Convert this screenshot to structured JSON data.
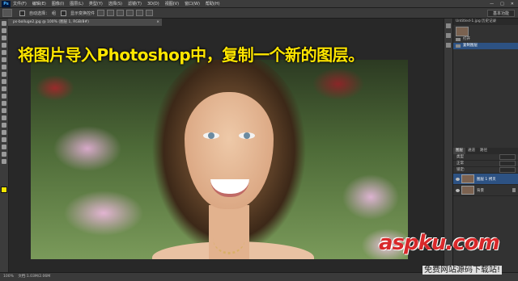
{
  "app": {
    "logo": "Ps"
  },
  "menubar": {
    "items": [
      "文件(F)",
      "编辑(E)",
      "图像(I)",
      "图层(L)",
      "类型(Y)",
      "选择(S)",
      "滤镜(T)",
      "3D(D)",
      "视图(V)",
      "窗口(W)",
      "帮助(H)"
    ],
    "window_controls": [
      "—",
      "□",
      "✕"
    ]
  },
  "options_bar": {
    "auto_select_label": "自动选择：",
    "group_value": "组",
    "show_transform_label": "显示变换控件",
    "workspace": "基本功能"
  },
  "document": {
    "tab_label": "ps-bolluge2.jpg @ 100% (图层 1, RGB/8#)",
    "caption": "将图片导入Photoshop中，复制一个新的图层。"
  },
  "history_panel": {
    "header": "Untitled-1.jpg 历史记录",
    "items": [
      {
        "label": "打开"
      },
      {
        "label": "复制图层"
      }
    ]
  },
  "layers_panel": {
    "tabs": [
      "图层",
      "通道",
      "路径"
    ],
    "kind_label": "类型",
    "mode_label": "正常",
    "lock_label": "锁定:",
    "layers": [
      {
        "name": "图层 1 拷贝"
      },
      {
        "name": "背景"
      }
    ]
  },
  "status_bar": {
    "zoom": "100%",
    "doc_info": "文档:1.03M/2.06M"
  },
  "watermark": {
    "brand": "aspku.com",
    "tagline": "免费网站源码下载站!"
  },
  "colors": {
    "caption": "#ffe600",
    "foreground_swatch": "#f4e600",
    "selection": "#2d5283",
    "watermark": "#d8282a"
  }
}
